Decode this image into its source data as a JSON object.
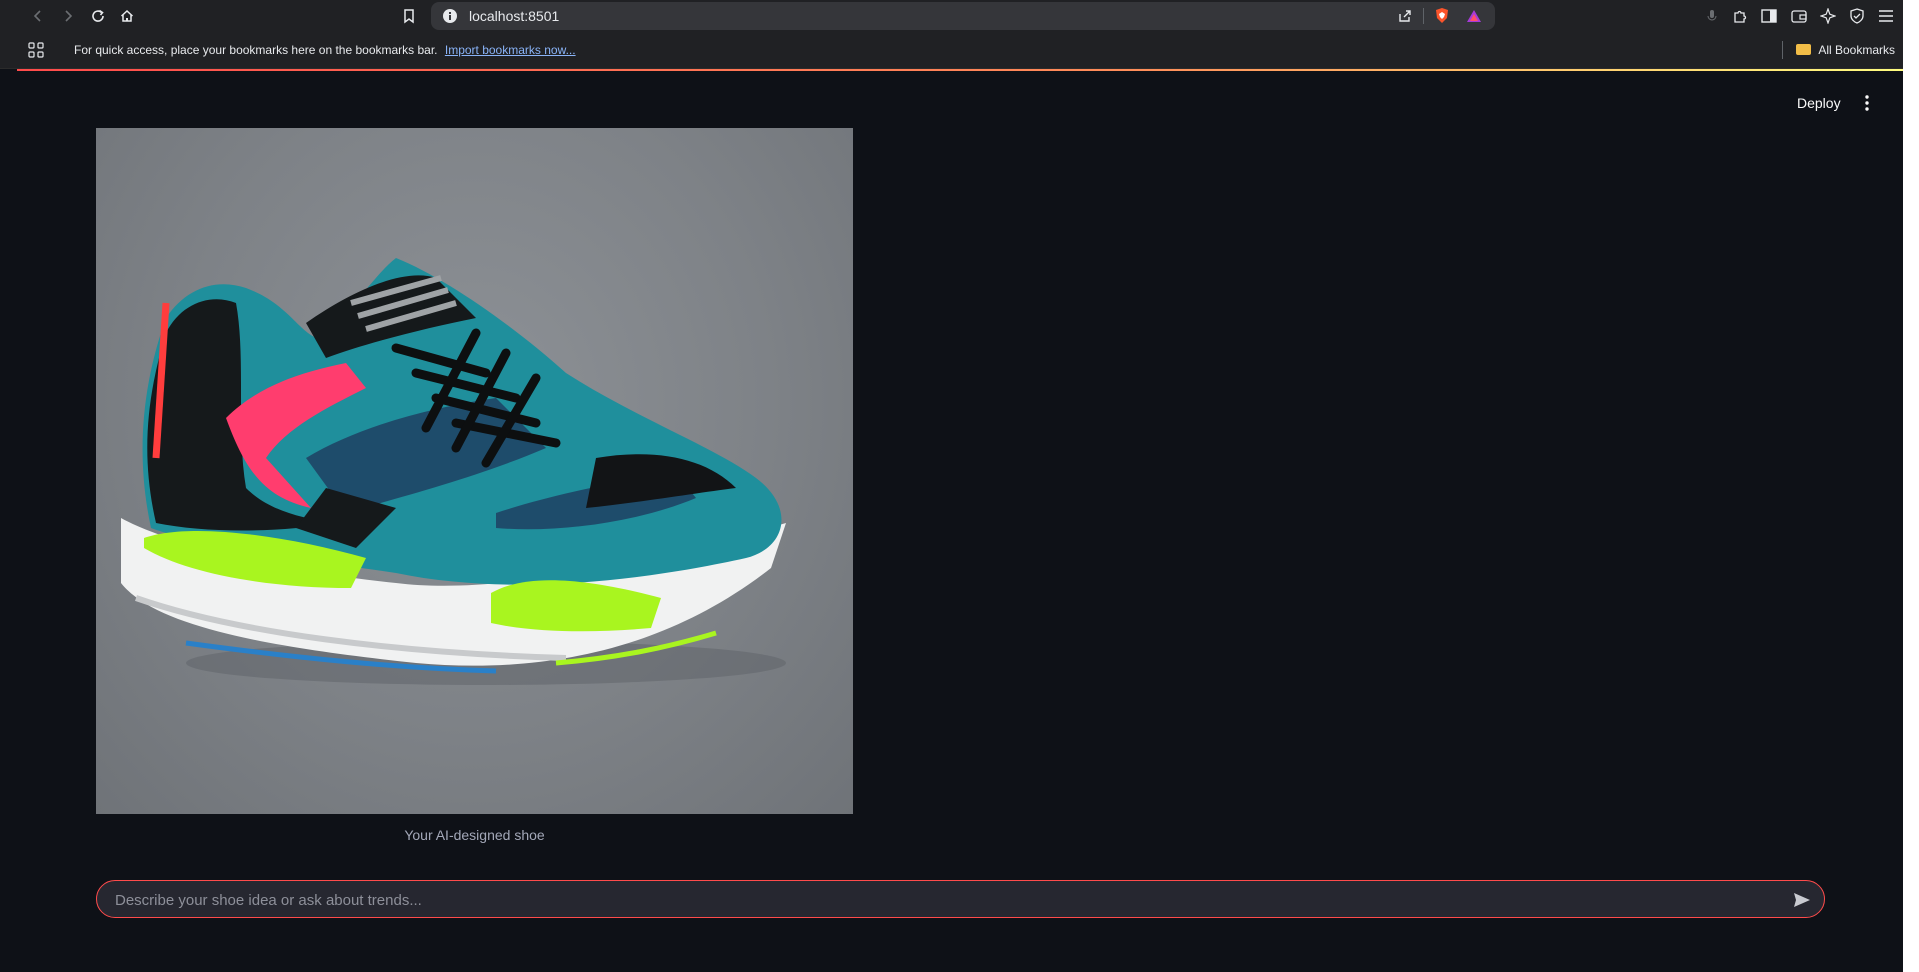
{
  "browser": {
    "url": "localhost:8501",
    "bookmarks_bar_message": "For quick access, place your bookmarks here on the bookmarks bar.",
    "import_link": "Import bookmarks now...",
    "all_bookmarks": "All Bookmarks"
  },
  "app": {
    "deploy_label": "Deploy",
    "image_caption": "Your AI-designed shoe",
    "chat_placeholder": "Describe your shoe idea or ask about trends...",
    "accent_color": "#ff4b4b",
    "background_color": "#0e1117"
  }
}
